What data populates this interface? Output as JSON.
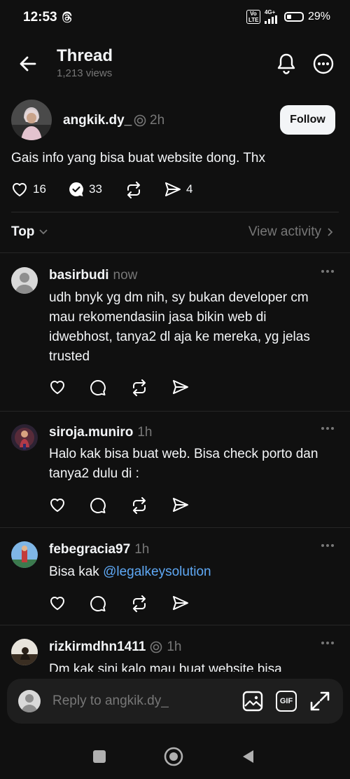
{
  "status_bar": {
    "time": "12:53",
    "volte": "Vo LTE",
    "network": "4G+",
    "battery": "29%"
  },
  "header": {
    "title": "Thread",
    "views": "1,213 views"
  },
  "post": {
    "username": "angkik.dy_",
    "time": "2h",
    "follow_label": "Follow",
    "text": "Gais info yang bisa buat website dong. Thx",
    "likes": "16",
    "replies": "33",
    "shares": "4"
  },
  "sort": {
    "label": "Top",
    "view_activity": "View activity"
  },
  "replies": [
    {
      "username": "basirbudi",
      "time": "now",
      "text": "udh bnyk yg dm nih, sy bukan developer cm mau rekomendasiin jasa bikin web di idwebhost, tanya2 dl aja ke mereka, yg jelas trusted"
    },
    {
      "username": "siroja.muniro",
      "time": "1h",
      "text": "Halo kak bisa buat web. Bisa check porto dan tanya2 dulu di :"
    },
    {
      "username": "febegracia97",
      "time": "1h",
      "text": "Bisa kak ",
      "mention": "@legalkeysolution"
    },
    {
      "username": "rizkirmdhn1411",
      "time": "1h",
      "text": "Dm kak sini kalo mau buat website bisa"
    }
  ],
  "composer": {
    "placeholder": "Reply to angkik.dy_",
    "gif_label": "GIF"
  },
  "colors": {
    "background": "#101010",
    "text": "#f3f5f7",
    "muted": "#777777",
    "link": "#5fa9f6",
    "follow_button": "#f3f5f7"
  }
}
